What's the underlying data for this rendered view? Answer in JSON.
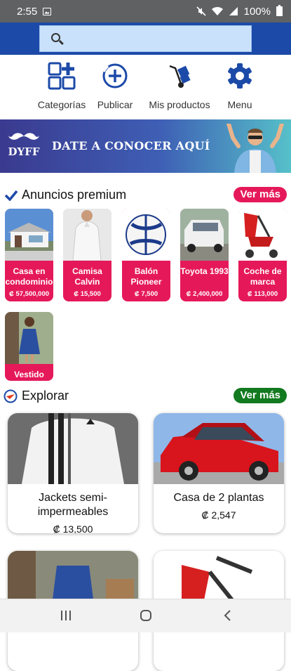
{
  "status_bar": {
    "time": "2:55",
    "battery": "100%"
  },
  "search": {
    "placeholder": ""
  },
  "nav": [
    {
      "label": "Categorías",
      "icon": "categories-icon"
    },
    {
      "label": "Publicar",
      "icon": "add-circle-icon"
    },
    {
      "label": "Mis productos",
      "icon": "hand-truck-icon"
    },
    {
      "label": "Menu",
      "icon": "gear-icon"
    }
  ],
  "banner": {
    "logo": "DYFF",
    "tagline": "DATE A CONOCER AQUÍ"
  },
  "premium": {
    "title": "Anuncios premium",
    "more": "Ver más",
    "items": [
      {
        "name": "Casa en condominio",
        "price": "₡ 57,500,000"
      },
      {
        "name": "Camisa Calvin",
        "price": "₡ 15,500"
      },
      {
        "name": "Balón Pioneer",
        "price": "₡ 7,500"
      },
      {
        "name": "Toyota 1993",
        "price": "₡ 2,400,000"
      },
      {
        "name": "Coche de marca",
        "price": "₡ 113,000"
      },
      {
        "name": "Vestido",
        "price": ""
      }
    ]
  },
  "explore": {
    "title": "Explorar",
    "more": "Ver más",
    "items": [
      {
        "name": "Jackets semi-impermeables",
        "price": "₡ 13,500"
      },
      {
        "name": "Casa de 2 plantas",
        "price": "₡ 2,547"
      },
      {
        "name": "",
        "price": ""
      },
      {
        "name": "",
        "price": ""
      }
    ]
  },
  "colors": {
    "primary": "#1c4aa8",
    "premium_pink": "#e5195a",
    "explore_green": "#127a1f",
    "search_bg": "#c9e1fb"
  }
}
